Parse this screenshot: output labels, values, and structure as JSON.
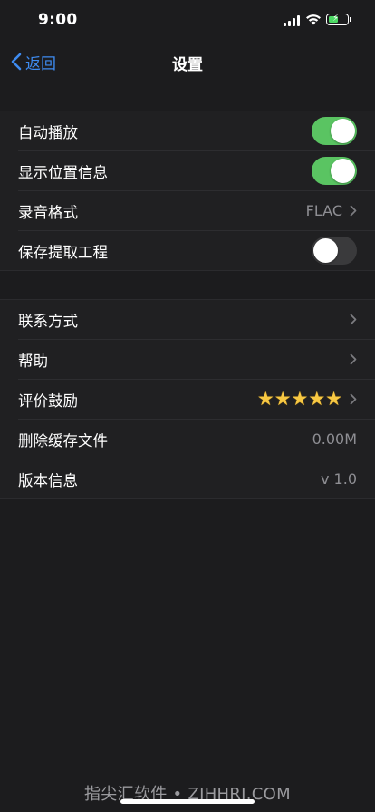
{
  "status_bar": {
    "time": "9:00",
    "icons": [
      "cellular-signal-icon",
      "wifi-icon",
      "battery-charging-icon"
    ],
    "battery_color": "#4cd964"
  },
  "nav": {
    "back_label": "返回",
    "title": "设置",
    "accent_color": "#3e8bf0"
  },
  "group1": {
    "rows": [
      {
        "label": "自动播放",
        "toggle": "on"
      },
      {
        "label": "显示位置信息",
        "toggle": "on"
      },
      {
        "label": "录音格式",
        "value": "FLAC"
      },
      {
        "label": "保存提取工程",
        "toggle": "off"
      }
    ]
  },
  "group2": {
    "rows": [
      {
        "label": "联系方式"
      },
      {
        "label": "帮助"
      },
      {
        "label": "评价鼓励",
        "rating": 5,
        "rating_max": 5
      },
      {
        "label": "删除缓存文件",
        "value": "0.00M"
      },
      {
        "label": "版本信息",
        "value": "v 1.0"
      }
    ]
  },
  "toggle_on_color": "#5ac462",
  "watermark": "指尖汇软件 • ZJHHRJ.COM"
}
